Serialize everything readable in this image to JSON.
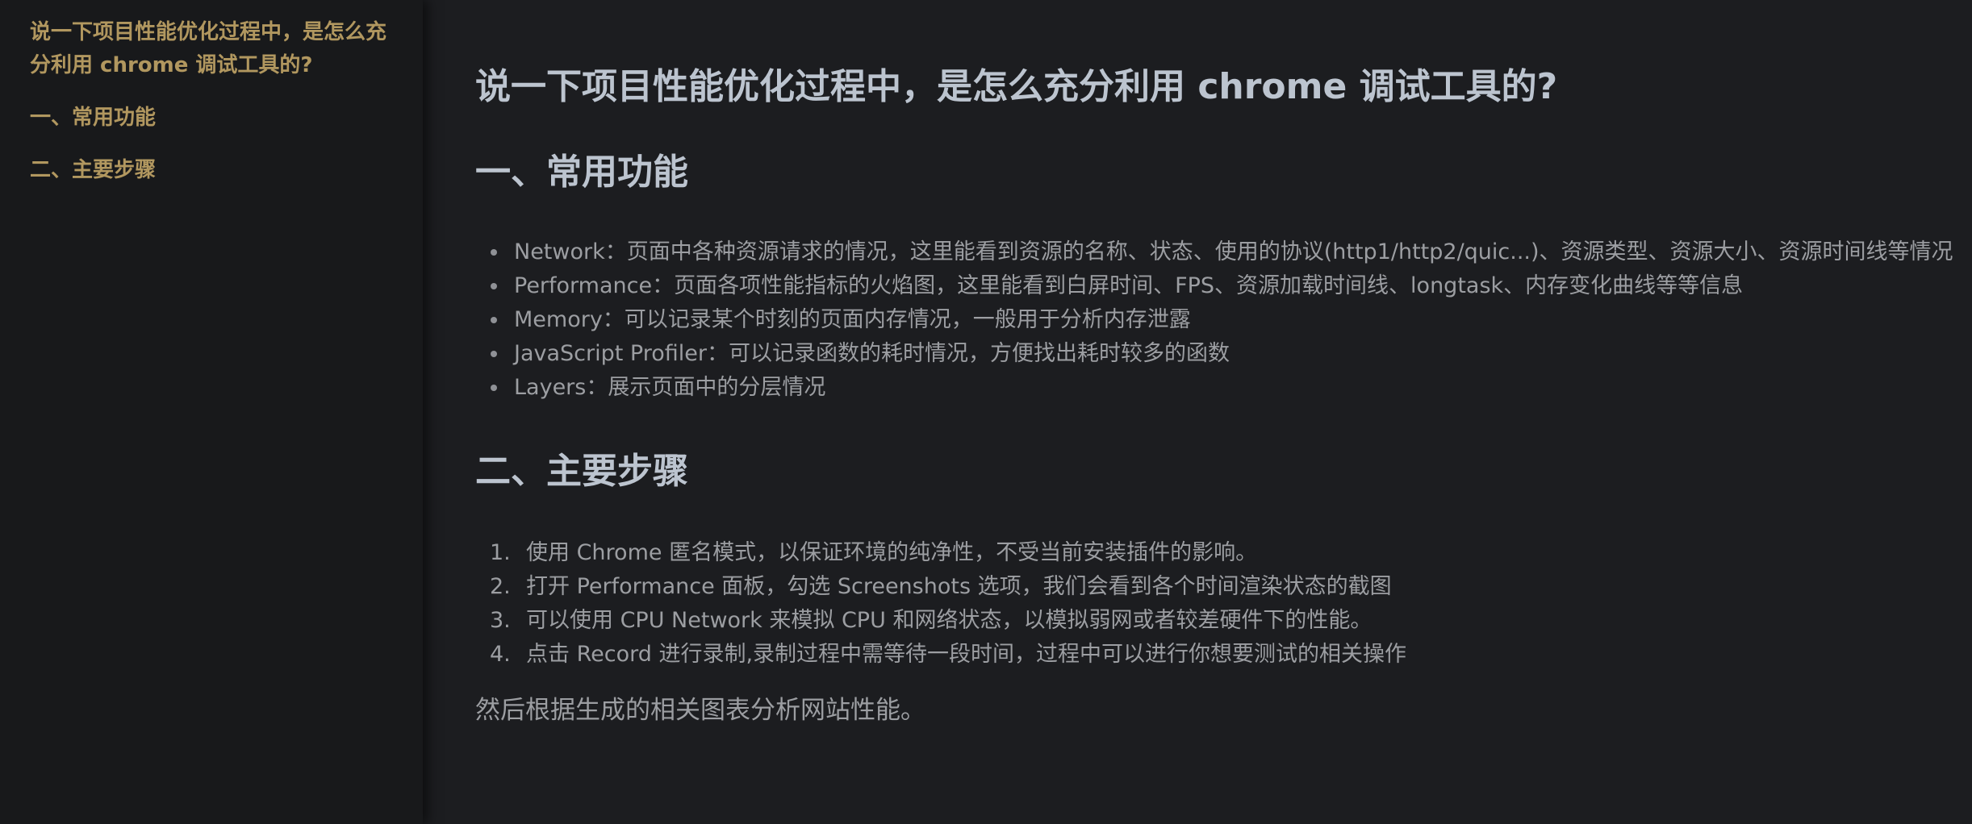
{
  "sidebar": {
    "items": [
      {
        "label": "说一下项目性能优化过程中，是怎么充分利用 chrome 调试工具的?"
      },
      {
        "label": "一、常用功能"
      },
      {
        "label": "二、主要步骤"
      }
    ]
  },
  "article": {
    "title": "说一下项目性能优化过程中，是怎么充分利用 chrome 调试工具的?",
    "sections": {
      "features": {
        "heading": "一、常用功能",
        "items": [
          "Network：页面中各种资源请求的情况，这里能看到资源的名称、状态、使用的协议(http1/http2/quic...)、资源类型、资源大小、资源时间线等情况",
          "Performance：页面各项性能指标的火焰图，这里能看到白屏时间、FPS、资源加载时间线、longtask、内存变化曲线等等信息",
          "Memory：可以记录某个时刻的页面内存情况，一般用于分析内存泄露",
          "JavaScript Profiler：可以记录函数的耗时情况，方便找出耗时较多的函数",
          "Layers：展示页面中的分层情况"
        ]
      },
      "steps": {
        "heading": "二、主要步骤",
        "items": [
          {
            "num": "1.",
            "text": "使用 Chrome 匿名模式，以保证环境的纯净性，不受当前安装插件的影响。"
          },
          {
            "num": "2.",
            "text": "打开 Performance 面板，勾选 Screenshots 选项，我们会看到各个时间渲染状态的截图"
          },
          {
            "num": "3.",
            "text": "可以使用 CPU Network 来模拟 CPU 和网络状态，以模拟弱网或者较差硬件下的性能。"
          },
          {
            "num": "4.",
            "text": "点击 Record 进行录制,录制过程中需等待一段时间，过程中可以进行你想要测试的相关操作"
          }
        ],
        "conclusion": "然后根据生成的相关图表分析网站性能。"
      }
    }
  },
  "colors": {
    "background": "#1c1d20",
    "sidebar_background": "#18191b",
    "toc_link": "#b1975f",
    "heading": "#bcc4cf",
    "body_text": "#9c9ea2"
  }
}
